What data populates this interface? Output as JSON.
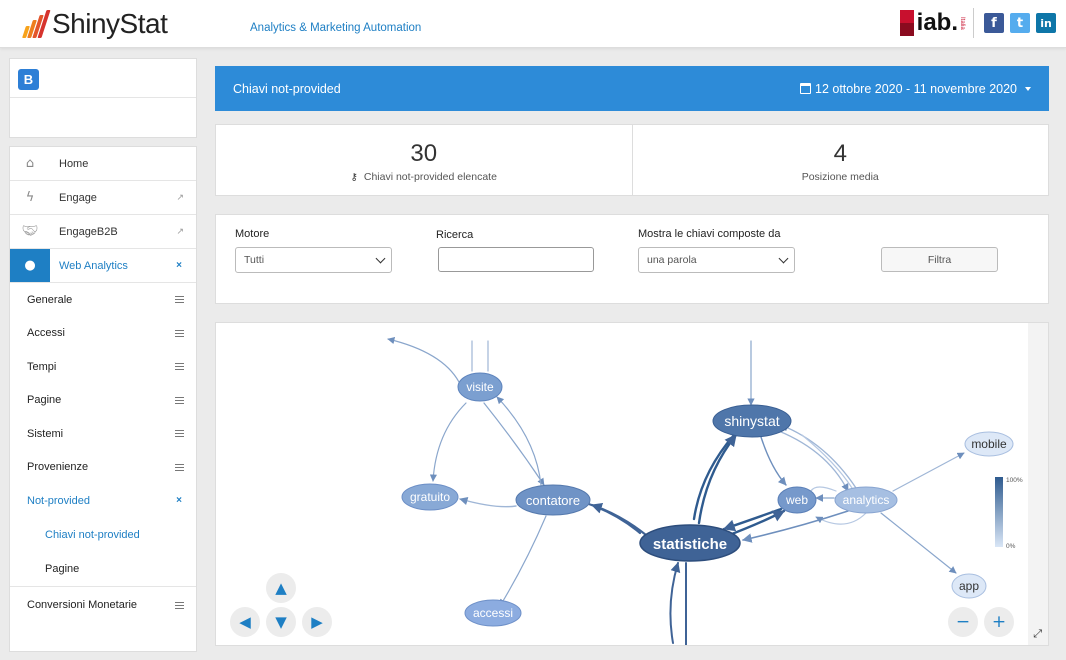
{
  "header": {
    "brand": "ShinyStat",
    "tagline": "Analytics & Marketing Automation",
    "partner": "iab.",
    "partner_sub": "Italia",
    "social": [
      {
        "name": "facebook",
        "glyph": "f",
        "color": "#3b5998"
      },
      {
        "name": "twitter",
        "glyph": "t",
        "color": "#55acee"
      },
      {
        "name": "linkedin",
        "glyph": "in",
        "color": "#0e76a8"
      }
    ],
    "logo_colors": [
      "#f7a21b",
      "#ee7d1e",
      "#e3552a",
      "#d6332d"
    ]
  },
  "sidebar": {
    "brand_logo": "B",
    "items": [
      {
        "label": "Home",
        "icon": "home-icon"
      },
      {
        "label": "Engage",
        "icon": "bolt-icon"
      },
      {
        "label": "EngageB2B",
        "icon": "handshake-icon"
      },
      {
        "label": "Web Analytics",
        "icon": "globe-icon"
      }
    ],
    "sub_items": [
      {
        "label": "Generale"
      },
      {
        "label": "Accessi"
      },
      {
        "label": "Tempi"
      },
      {
        "label": "Pagine"
      },
      {
        "label": "Sistemi"
      },
      {
        "label": "Provenienze"
      },
      {
        "label": "Not-provided"
      }
    ],
    "sub2_items": [
      {
        "label": "Chiavi not-provided"
      },
      {
        "label": "Pagine"
      }
    ],
    "conversion": "Conversioni Monetarie",
    "close_glyph": "×"
  },
  "main": {
    "title": "Chiavi not-provided",
    "date_range": "12 ottobre 2020 - 11 novembre 2020",
    "stats": [
      {
        "value": "30",
        "caption": "Chiavi not-provided elencate"
      },
      {
        "value": "4",
        "caption": "Posizione media"
      }
    ],
    "filters": {
      "motore_label": "Motore",
      "motore_value": "Tutti",
      "ricerca_label": "Ricerca",
      "ricerca_value": "",
      "composte_label": "Mostra le chiavi composte da",
      "composte_value": "una parola",
      "filtra_label": "Filtra"
    },
    "graph": {
      "legend_max": "100%",
      "legend_min": "0%",
      "nodes": [
        {
          "id": "visite",
          "label": "visite"
        },
        {
          "id": "gratuito",
          "label": "gratuito"
        },
        {
          "id": "contatore",
          "label": "contatore"
        },
        {
          "id": "accessi",
          "label": "accessi"
        },
        {
          "id": "statistiche",
          "label": "statistiche"
        },
        {
          "id": "shinystat",
          "label": "shinystat"
        },
        {
          "id": "web",
          "label": "web"
        },
        {
          "id": "analytics",
          "label": "analytics"
        },
        {
          "id": "mobile",
          "label": "mobile"
        },
        {
          "id": "app",
          "label": "app"
        }
      ],
      "controls": {
        "up": "▲",
        "down": "▼",
        "left": "◀",
        "right": "▶",
        "zoom_out": "−",
        "zoom_in": "+",
        "fullscreen": "⤢"
      }
    }
  }
}
